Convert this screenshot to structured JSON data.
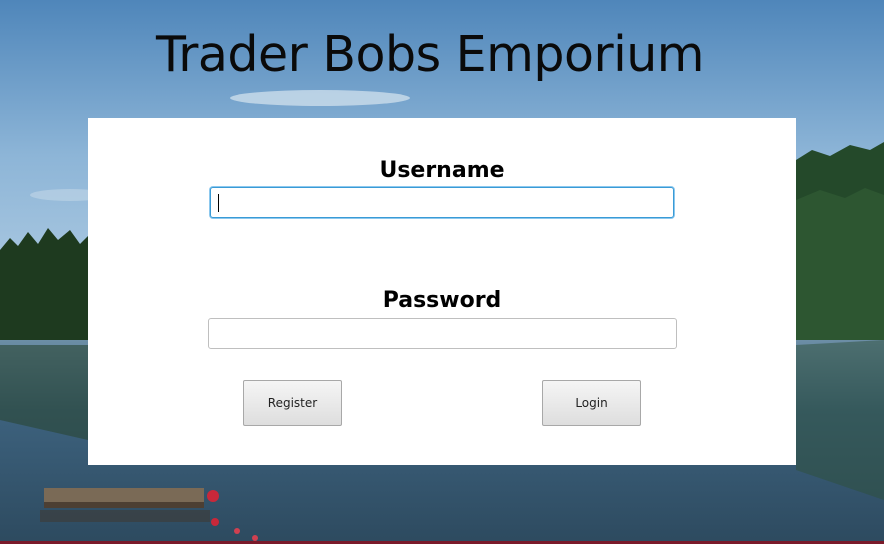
{
  "app": {
    "title": "Trader Bobs Emporium"
  },
  "login_form": {
    "username_label": "Username",
    "username_value": "",
    "password_label": "Password",
    "password_value": "",
    "register_button": "Register",
    "login_button": "Login"
  },
  "colors": {
    "panel_background": "#ffffff",
    "focus_ring": "#3a9bd6",
    "sky": "#6f9fc6",
    "lake": "#3f6f8f",
    "forest": "#1f3a1c"
  }
}
